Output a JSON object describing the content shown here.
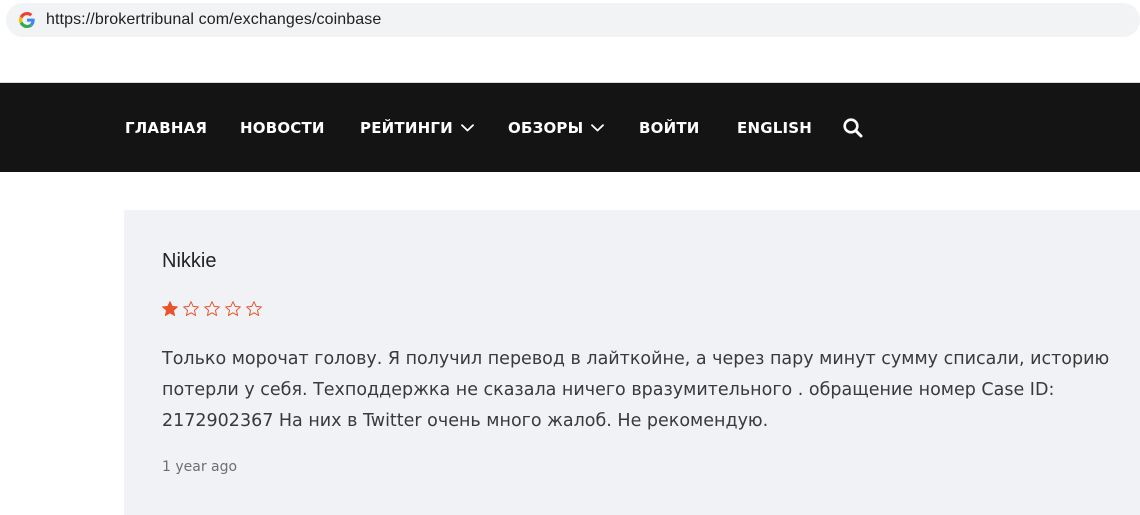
{
  "browser": {
    "url": "https://brokertribunal com/exchanges/coinbase",
    "favicon_icon": "google-g-icon"
  },
  "nav": {
    "items": [
      {
        "label": "ГЛАВНАЯ",
        "has_dropdown": false
      },
      {
        "label": "НОВОСТИ",
        "has_dropdown": false
      },
      {
        "label": "РЕЙТИНГИ",
        "has_dropdown": true
      },
      {
        "label": "ОБЗОРЫ",
        "has_dropdown": true
      },
      {
        "label": "ВОЙТИ",
        "has_dropdown": false
      },
      {
        "label": "ENGLISH",
        "has_dropdown": false
      }
    ],
    "search_icon": "search-icon",
    "background": "#141414",
    "text_color": "#ffffff"
  },
  "review": {
    "author": "Nikkie",
    "rating": 1,
    "rating_max": 5,
    "star_color": "#e8542c",
    "text": "Только морочат голову. Я получил перевод в лайткойне, а через пару минут сумму списали, историю потерли у себя. Техподдержка не сказала ничего вразумительного . обращение номер Case ID: 2172902367 На них в Twitter очень много жалоб. Не рекомендую.",
    "time": "1 year ago",
    "card_background": "#f0f2f5"
  }
}
